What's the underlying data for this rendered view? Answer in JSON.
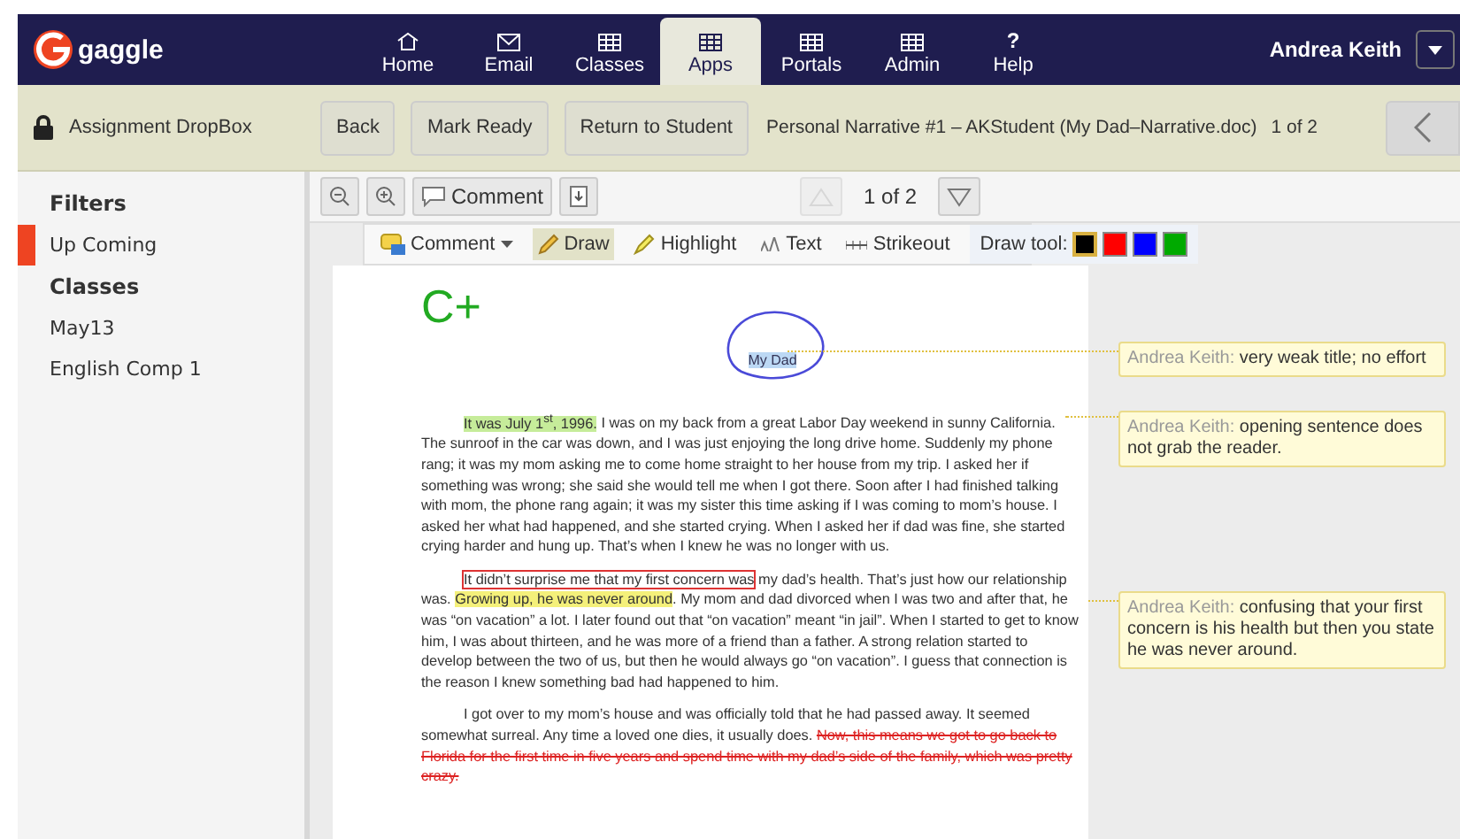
{
  "topbar": {
    "logo": "gaggle",
    "nav": [
      {
        "kind": "home",
        "label": "Home",
        "selected": false
      },
      {
        "kind": "email",
        "label": "Email",
        "selected": false
      },
      {
        "kind": "grid",
        "label": "Classes",
        "selected": false
      },
      {
        "kind": "apps",
        "label": "Apps",
        "selected": true
      },
      {
        "kind": "grid",
        "label": "Portals",
        "selected": false
      },
      {
        "kind": "grid",
        "label": "Admin",
        "selected": false
      },
      {
        "kind": "help",
        "label": "Help",
        "glyph": "?",
        "selected": false
      }
    ],
    "user": "Andrea Keith"
  },
  "toolbar": {
    "section": "Assignment DropBox",
    "buttons": [
      "Back",
      "Mark Ready",
      "Return to Student"
    ],
    "document_title": "Personal Narrative #1 – AKStudent (My Dad–Narrative.doc)",
    "position": "1 of 2"
  },
  "sidebar": {
    "sections": [
      {
        "heading": "Filters",
        "items": [
          {
            "label": "Up Coming",
            "selected": true
          }
        ]
      },
      {
        "heading": "Classes",
        "items": [
          {
            "label": "May13",
            "selected": false
          },
          {
            "label": "English Comp 1",
            "selected": false
          }
        ]
      }
    ]
  },
  "viewer": {
    "comment_button": "Comment",
    "page_indicator": "1 of 2",
    "tools": [
      {
        "kind": "comment",
        "label": "Comment",
        "selected": false
      },
      {
        "kind": "draw",
        "label": "Draw",
        "selected": true
      },
      {
        "kind": "highlight",
        "label": "Highlight",
        "selected": false
      },
      {
        "kind": "text",
        "label": "Text",
        "selected": false
      },
      {
        "kind": "strikeout",
        "label": "Strikeout",
        "selected": false
      }
    ],
    "draw_tool_label": "Draw tool:",
    "draw_colors": [
      {
        "color": "#000000",
        "selected": true
      },
      {
        "color": "#ff0000",
        "selected": false
      },
      {
        "color": "#0000ff",
        "selected": false
      },
      {
        "color": "#00aa00",
        "selected": false
      }
    ]
  },
  "document": {
    "grade": "C+",
    "title": "My Dad",
    "paragraphs": [
      [
        {
          "kind": "green",
          "text": "It was July 1$^{st}$, 1996."
        },
        {
          "kind": "plain",
          "text": " I was on my back from a great Labor Day weekend in sunny California. The sunroof in the car was down, and I was just enjoying the long drive home. Suddenly my phone rang; it was my mom asking me to come home straight to her house from my trip. I asked her if something was wrong; she said she would tell me when I got there. Soon after I had finished talking with mom, the phone rang again; it was my sister this time asking if I was coming to mom’s house. I asked her what had happened, and she started crying. When I asked her if dad was fine, she started crying harder and hung up. That’s when I knew he was no longer with us."
        }
      ],
      [
        {
          "kind": "boxed",
          "text": "It didn’t surprise me that my first concern was"
        },
        {
          "kind": "plain",
          "text": " my dad’s health. That’s just how our relationship was. "
        },
        {
          "kind": "yellow",
          "text": "Growing up, he was never around"
        },
        {
          "kind": "plain",
          "text": ". My mom and dad divorced when I was two and after that, he was “on vacation” a lot. I later found out that “on vacation” meant “in jail”. When I started to get to know him, I was about thirteen, and he was more of a friend than a father. A strong relation started to develop between the two of us, but then he would always go “on vacation”. I guess that connection is the reason I knew something bad had happened to him."
        }
      ],
      [
        {
          "kind": "plain",
          "text": "I got over to my mom’s house and was officially told that he had passed away. It seemed somewhat surreal. Any time a loved one dies, it usually does. "
        },
        {
          "kind": "strike",
          "text": "Now, this means we got to go back to Florida for the first time in five years and spend time with my dad’s side of the family, which was pretty crazy."
        }
      ]
    ]
  },
  "comments": [
    {
      "author": "Andrea Keith:",
      "text": "very weak title; no effort"
    },
    {
      "author": "Andrea Keith:",
      "text": "opening sentence does not grab the reader."
    },
    {
      "author": "Andrea Keith:",
      "text": "confusing that your first concern is his health but then you state he was never around."
    }
  ]
}
